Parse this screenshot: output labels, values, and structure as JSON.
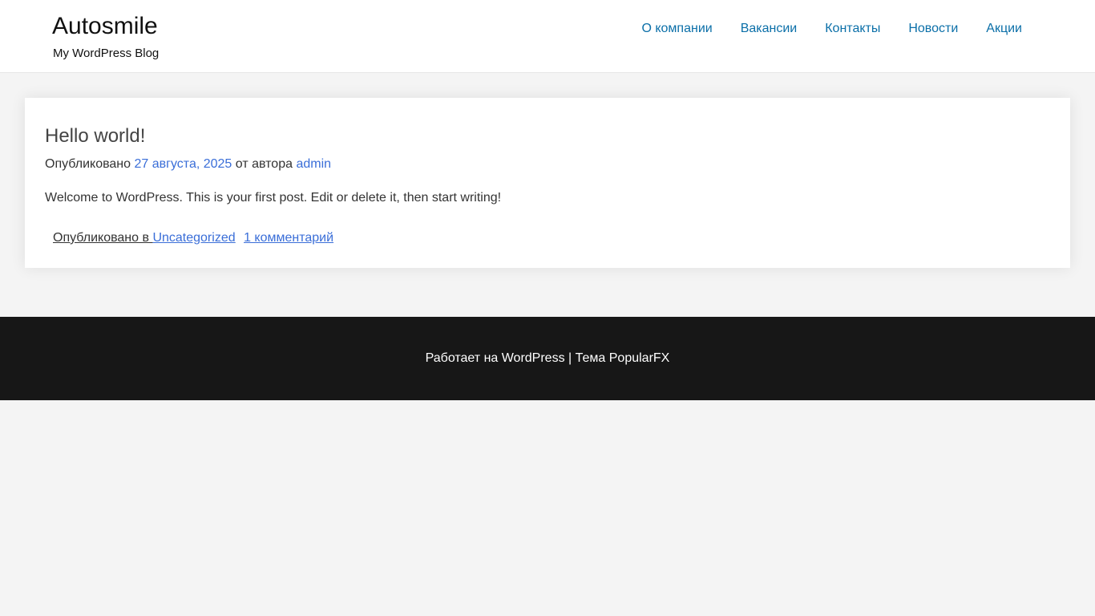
{
  "header": {
    "site_title": "Autosmile",
    "tagline": "My WordPress Blog",
    "nav": [
      {
        "label": "О компании"
      },
      {
        "label": "Вакансии"
      },
      {
        "label": "Контакты"
      },
      {
        "label": "Новости"
      },
      {
        "label": "Акции"
      }
    ]
  },
  "post": {
    "title": "Hello world!",
    "meta_prefix": "Опубликовано",
    "date": "27 августа, 2025",
    "author_prefix": "от автора",
    "author": "admin",
    "content": "Welcome to WordPress. This is your first post. Edit or delete it, then start writing!",
    "footer_prefix": "Опубликовано в",
    "category": "Uncategorized",
    "comments": "1 комментарий"
  },
  "footer": {
    "powered_by": "Работает на WordPress",
    "separator": "|",
    "theme": "Тема PopularFX"
  },
  "colors": {
    "nav_link": "#0b6fa8",
    "link": "#3a6ed8",
    "footer_bg": "#171717",
    "page_bg": "#f4f4f4"
  }
}
